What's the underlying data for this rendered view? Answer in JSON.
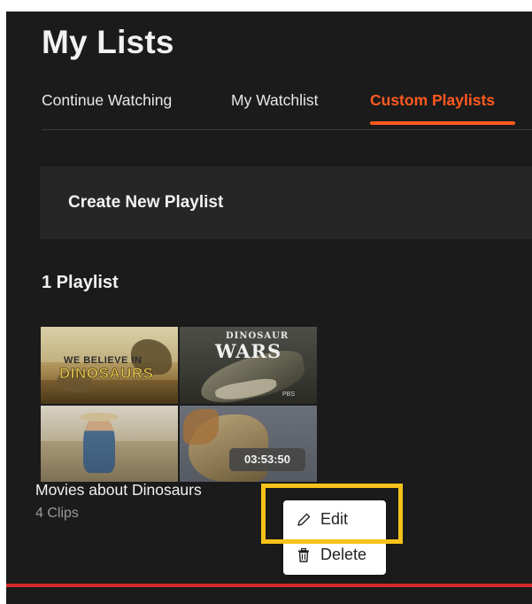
{
  "page": {
    "title": "My Lists"
  },
  "tabs": [
    {
      "label": "Continue Watching",
      "active": false
    },
    {
      "label": "My Watchlist",
      "active": false
    },
    {
      "label": "Custom Playlists",
      "active": true
    }
  ],
  "create_playlist": {
    "label": "Create New Playlist"
  },
  "playlists_section": {
    "count_label": "1 Playlist"
  },
  "playlist_card": {
    "title": "Movies about Dinosaurs",
    "meta": "4 Clips",
    "duration": "03:53:50",
    "thumbnails": [
      {
        "line1": "WE BELIEVE IN",
        "line2": "DINOSAURS"
      },
      {
        "line1": "DINOSAUR",
        "line2": "WARS",
        "badge": "PBS"
      },
      {},
      {}
    ],
    "more_label": "•••"
  },
  "context_menu": {
    "items": [
      {
        "label": "Edit",
        "icon": "pencil-icon"
      },
      {
        "label": "Delete",
        "icon": "trash-icon"
      }
    ]
  },
  "colors": {
    "accent": "#ff5a1f",
    "background": "#1b1b1b",
    "panel": "#262626",
    "highlight": "#f6c21a",
    "bottom_bar": "#d42a2a"
  }
}
